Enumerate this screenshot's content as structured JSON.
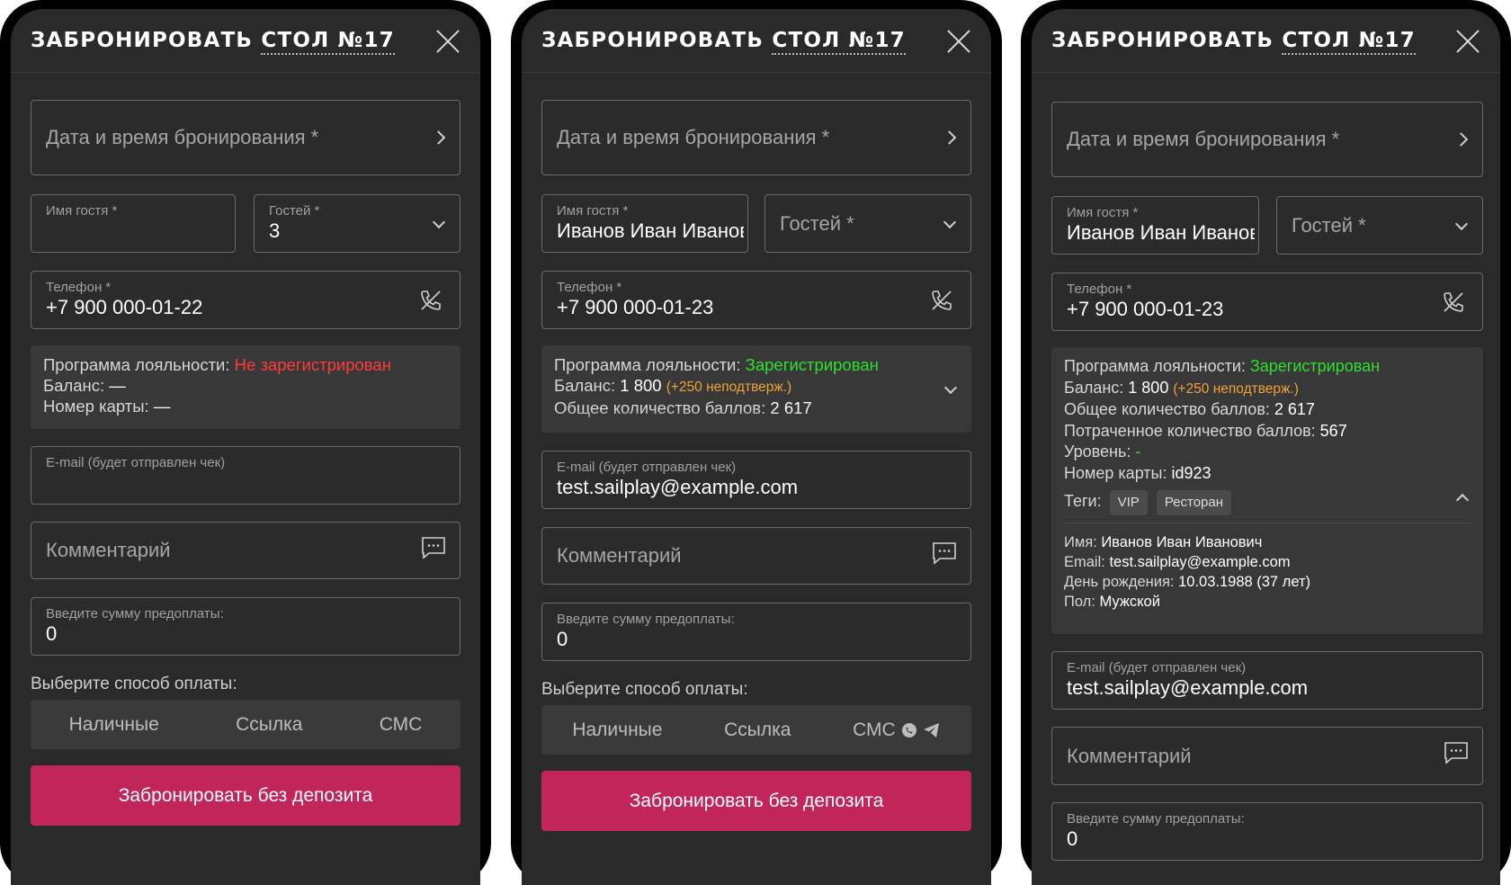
{
  "modal": {
    "title": "ЗАБРОНИРОВАТЬ",
    "table": "СТОЛ №17"
  },
  "form": {
    "datetime_placeholder": "Дата и время бронирования *",
    "guest_name_label": "Имя гостя *",
    "guests_label": "Гостей *",
    "phone_label": "Телефон *",
    "email_label": "E-mail (будет отправлен чек)",
    "comment_placeholder": "Комментарий",
    "prepay_label": "Введите сумму предоплаты:",
    "prepay_value": "0",
    "payment_label": "Выберите способ оплаты:",
    "payment_options": [
      "Наличные",
      "Ссылка",
      "СМС"
    ],
    "submit_label": "Забронировать без депозита"
  },
  "loyalty_labels": {
    "program": "Программа лояльности: ",
    "balance": "Баланс: ",
    "card": "Номер карты: ",
    "total_points": "Общее количество баллов: ",
    "spent_points": "Потраченное количество баллов: ",
    "level": "Уровень: ",
    "tags": "Теги: ",
    "name": "Имя: ",
    "email": "Email: ",
    "birthday": "День рождения: ",
    "gender": "Пол: "
  },
  "screens": [
    {
      "guests_value": "3",
      "phone_value": "+7 900 000-01-22",
      "loyalty_status": "Не зарегистрирован",
      "balance": "—",
      "card": "—"
    },
    {
      "guest_name": "Иванов Иван Иванович",
      "phone_value": "+7 900 000-01-23",
      "loyalty_status": "Зарегистрирован",
      "balance": "1 800",
      "pending": "(+250 неподтверж.)",
      "total_points": "2 617",
      "email_value": "test.sailplay@example.com"
    },
    {
      "guest_name": "Иванов Иван Иванович",
      "phone_value": "+7 900 000-01-23",
      "loyalty_status": "Зарегистрирован",
      "balance": "1 800",
      "pending": "(+250 неподтверж.)",
      "total_points": "2 617",
      "spent_points": "567",
      "level": "-",
      "card": "id923",
      "tags": [
        "VIP",
        "Ресторан"
      ],
      "name": "Иванов Иван Иванович",
      "email": "test.sailplay@example.com",
      "birthday": "10.03.1988 (37 лет)",
      "gender": "Мужской",
      "email_value": "test.sailplay@example.com"
    }
  ],
  "colors": {
    "background": "#2a2a2a",
    "primary_button": "#c2255a",
    "status_unregistered": "#ff3b3b",
    "status_registered": "#2ee02e",
    "pending": "#f0a13a"
  },
  "icons": [
    "close-icon",
    "chevron-right-icon",
    "chevron-down-icon",
    "chevron-up-icon",
    "phone-call-icon",
    "comment-icon",
    "whatsapp-icon",
    "telegram-icon"
  ]
}
